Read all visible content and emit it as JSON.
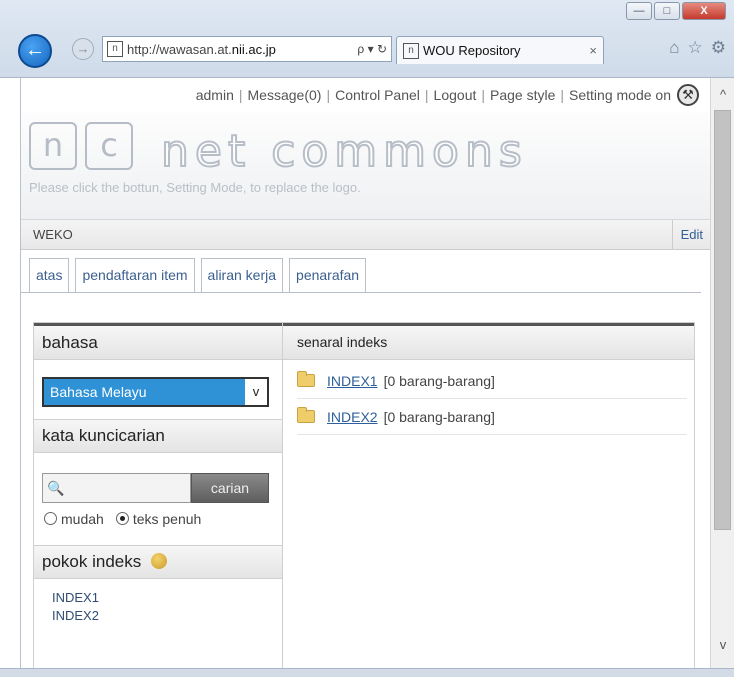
{
  "browser": {
    "url_prefix": "http://wawasan.at.",
    "url_host": "nii.ac.jp",
    "addr_tools": "ρ ▾ ↻",
    "tab_title": "WOU Repository",
    "tab_close": "×",
    "back_glyph": "←",
    "forward_glyph": "→",
    "favicon_glyph": "n",
    "home_glyph": "⌂",
    "star_glyph": "☆",
    "gear_glyph": "⚙",
    "minimize": "—",
    "maximize": "□",
    "close": "X",
    "scroll_up": "^",
    "scroll_down": "v"
  },
  "topmenu": {
    "admin": "admin",
    "message": "Message(0)",
    "control_panel": "Control Panel",
    "logout": "Logout",
    "page_style": "Page style",
    "setting_mode": "Setting mode on",
    "separator": "|",
    "wrench_glyph": "⚒"
  },
  "logo": {
    "box1": "n",
    "box2": "c",
    "text": "net commons",
    "hint": "Please click the bottun, Setting Mode, to replace the logo."
  },
  "module": {
    "title": "WEKO",
    "edit": "Edit"
  },
  "tabs": [
    "atas",
    "pendaftaran item",
    "aliran kerja",
    "penarafan"
  ],
  "left": {
    "language_heading": "bahasa",
    "language_value": "Bahasa Melayu",
    "select_arrow": "v",
    "keyword_heading": "kata kuncicarian",
    "search_icon_glyph": "🔍",
    "search_button": "carian",
    "radio_simple": "mudah",
    "radio_full": "teks penuh",
    "index_heading": "pokok indeks",
    "index_items": [
      "INDEX1",
      "INDEX2"
    ]
  },
  "right": {
    "heading": "senaral indeks",
    "rows": [
      {
        "name": "INDEX1",
        "count": "[0 barang-barang]"
      },
      {
        "name": "INDEX2",
        "count": "[0 barang-barang]"
      }
    ]
  }
}
